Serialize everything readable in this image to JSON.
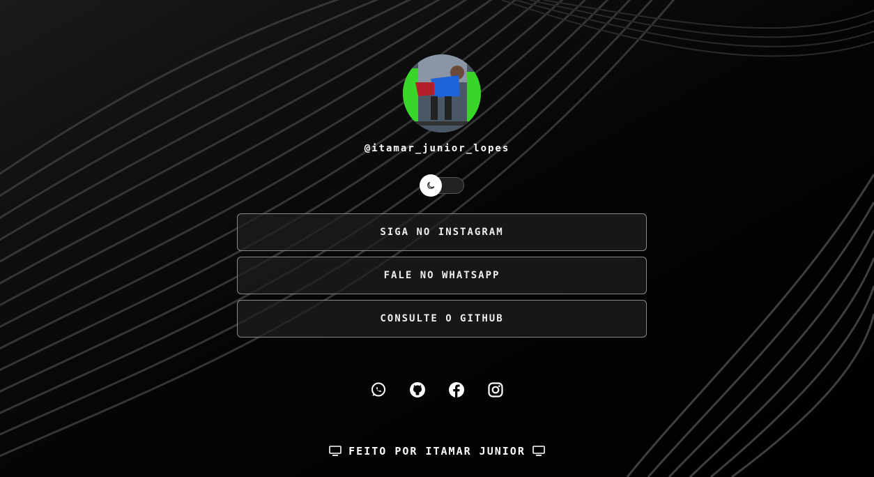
{
  "profile": {
    "handle": "@itamar_junior_lopes",
    "avatar_icon": "profile-photo"
  },
  "theme_toggle": {
    "icon": "moon-icon",
    "state": "dark"
  },
  "links": [
    {
      "label": "SIGA NO INSTAGRAM"
    },
    {
      "label": "FALE NO WHATSAPP"
    },
    {
      "label": "CONSULTE O GITHUB"
    }
  ],
  "social": [
    "whatsapp-icon",
    "github-icon",
    "facebook-icon",
    "instagram-icon"
  ],
  "footer": {
    "text": "FEITO POR ITAMAR JUNIOR",
    "icon": "computer-icon"
  },
  "colors": {
    "background": "#000000",
    "text": "#ffffff",
    "button_border": "#8a8a8a"
  }
}
